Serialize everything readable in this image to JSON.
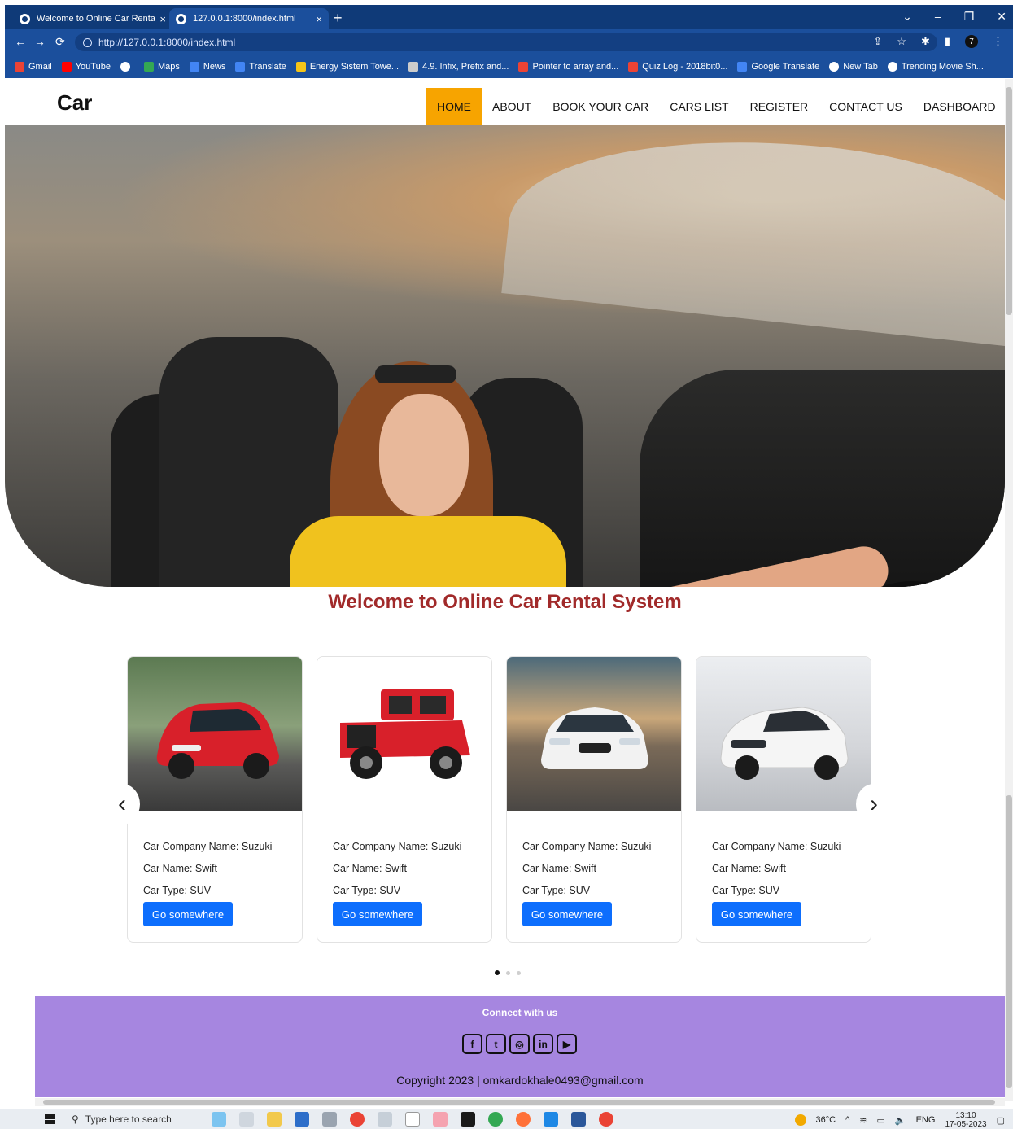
{
  "browser": {
    "tabs": [
      {
        "title": "Welcome to Online Car Rental sy",
        "active": false
      },
      {
        "title": "127.0.0.1:8000/index.html",
        "active": true
      }
    ],
    "url": "http://127.0.0.1:8000/index.html",
    "profile_initial": "7",
    "bookmarks": [
      "Gmail",
      "YouTube",
      "Maps",
      "News",
      "Translate",
      "Energy Sistem Towe...",
      "4.9. Infix, Prefix and...",
      "Pointer to array and...",
      "Quiz Log - 2018bit0...",
      "Google Translate",
      "New Tab",
      "Trending Movie Sh..."
    ],
    "bookmark_colors": [
      "#ea4335",
      "#ff0000",
      "#ffffff",
      "#34a853",
      "#4285f4",
      "#4285f4",
      "#f5c518",
      "#cccccc",
      "#ea4335",
      "#ea4335",
      "#4285f4",
      "#ffffff",
      "#ffffff"
    ]
  },
  "site": {
    "brand": "Car",
    "nav": [
      {
        "label": "HOME",
        "active": true
      },
      {
        "label": "ABOUT",
        "active": false
      },
      {
        "label": "BOOK YOUR CAR",
        "active": false
      },
      {
        "label": "CARS LIST",
        "active": false
      },
      {
        "label": "REGISTER",
        "active": false
      },
      {
        "label": "CONTACT US",
        "active": false
      },
      {
        "label": "DASHBOARD",
        "active": false
      }
    ],
    "accent_color": "#f7a400",
    "welcome": "Welcome to Online Car Rental System",
    "welcome_color": "#a12a2a"
  },
  "cards": [
    {
      "company": "Car Company Name: Suzuki",
      "name": "Car Name: Swift",
      "type": "Car Type: SUV",
      "button": "Go somewhere",
      "car_color": "#d8202a",
      "bg": "#7a9a6a"
    },
    {
      "company": "Car Company Name: Suzuki",
      "name": "Car Name: Swift",
      "type": "Car Type: SUV",
      "button": "Go somewhere",
      "car_color": "#d8202a",
      "bg": "#ffffff"
    },
    {
      "company": "Car Company Name: Suzuki",
      "name": "Car Name: Swift",
      "type": "Car Type: SUV",
      "button": "Go somewhere",
      "car_color": "#f2f2f2",
      "bg": "#8f8a80"
    },
    {
      "company": "Car Company Name: Suzuki",
      "name": "Car Name: Swift",
      "type": "Car Type: SUV",
      "button": "Go somewhere",
      "car_color": "#f5f5f5",
      "bg": "#d9dadd"
    }
  ],
  "carousel": {
    "prev": "‹",
    "next": "›",
    "dots": 3,
    "active_dot": 0
  },
  "footer": {
    "connect": "Connect with us",
    "socials": [
      "f",
      "t",
      "◎",
      "in",
      "▶"
    ],
    "copyright": "Copyright 2023 | omkardokhale0493@gmail.com",
    "bg": "#a686e0"
  },
  "taskbar": {
    "search_placeholder": "Type here to search",
    "temperature": "36°C",
    "lang": "ENG",
    "time": "13:10",
    "date": "17-05-2023"
  }
}
